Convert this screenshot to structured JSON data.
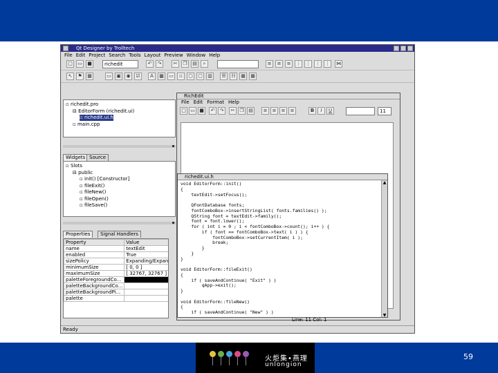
{
  "slide": {
    "page_number": "59",
    "colors": {
      "band": "#003a9a",
      "titlebar": "#2a2a8a"
    },
    "logo": {
      "text_cn": "火炬集•燕理",
      "text_en": "unlongion"
    }
  },
  "window": {
    "title": "Qt Designer by Trolltech",
    "menu": [
      "File",
      "Edit",
      "Project",
      "Search",
      "Tools",
      "Layout",
      "Preview",
      "Window",
      "Help"
    ],
    "toolbar": {
      "combo_value": "richedit"
    },
    "status": "Ready"
  },
  "project_tree": {
    "items": [
      {
        "label": "richedit.pro",
        "indent": 0
      },
      {
        "label": "EditorForm (richedit.ui)",
        "indent": 1,
        "prefix": "⊟"
      },
      {
        "label": "richedit.ui.h",
        "indent": 2,
        "selected": true
      },
      {
        "label": "main.cpp",
        "indent": 1
      }
    ]
  },
  "object_panel": {
    "tabs": [
      "Widgets",
      "Source"
    ],
    "items": [
      {
        "label": "Slots",
        "indent": 0
      },
      {
        "label": "public",
        "indent": 1,
        "prefix": "⊟"
      },
      {
        "label": "init() [Constructor]",
        "indent": 2
      },
      {
        "label": "fileExit()",
        "indent": 2
      },
      {
        "label": "fileNew()",
        "indent": 2
      },
      {
        "label": "fileOpen()",
        "indent": 2
      },
      {
        "label": "fileSave()",
        "indent": 2
      }
    ]
  },
  "property_editor": {
    "tabs": [
      "Properties",
      "Signal Handlers"
    ],
    "headers": [
      "Property",
      "Value"
    ],
    "rows": [
      {
        "name": "name",
        "value": "textEdit"
      },
      {
        "name": "enabled",
        "value": "True"
      },
      {
        "name": "sizePolicy",
        "value": "Expanding/Expand..."
      },
      {
        "name": "minimumSize",
        "value": "[ 0, 0 ]"
      },
      {
        "name": "maximumSize",
        "value": "[ 32767, 32767 ]"
      },
      {
        "name": "paletteForegroundCo...",
        "value": ""
      },
      {
        "name": "paletteBackgroundCo...",
        "value": ""
      },
      {
        "name": "paletteBackgroundPi...",
        "value": ""
      },
      {
        "name": "palette",
        "value": ""
      }
    ]
  },
  "rich_edit": {
    "title": "RichEdit",
    "menu": [
      "File",
      "Edit",
      "Format",
      "Help"
    ],
    "font_size": "11"
  },
  "code_editor": {
    "title": "richedit.ui.h",
    "lines": [
      "void EditorForm::init()",
      "{",
      "    textEdit->setFocus();",
      "",
      "    QFontDatabase fonts;",
      "    fontComboBox->insertStringList( fonts.families() );",
      "    QString font = textEdit->family();",
      "    font = font.lower();",
      "    for ( int i = 0 ; i < fontComboBox->count(); i++ ) {",
      "        if ( font == fontComboBox->text( i ) ) {",
      "            fontComboBox->setCurrentItem( i );",
      "            break;",
      "        }",
      "    }",
      "}",
      "",
      "void EditorForm::fileExit()",
      "{",
      "    if ( saveAndContinue( \"Exit\" ) )",
      "        qApp->exit();",
      "}",
      "",
      "void EditorForm::fileNew()",
      "{",
      "    if ( saveAndContinue( \"New\" ) )"
    ],
    "status": "Line: 11 Col: 1"
  }
}
